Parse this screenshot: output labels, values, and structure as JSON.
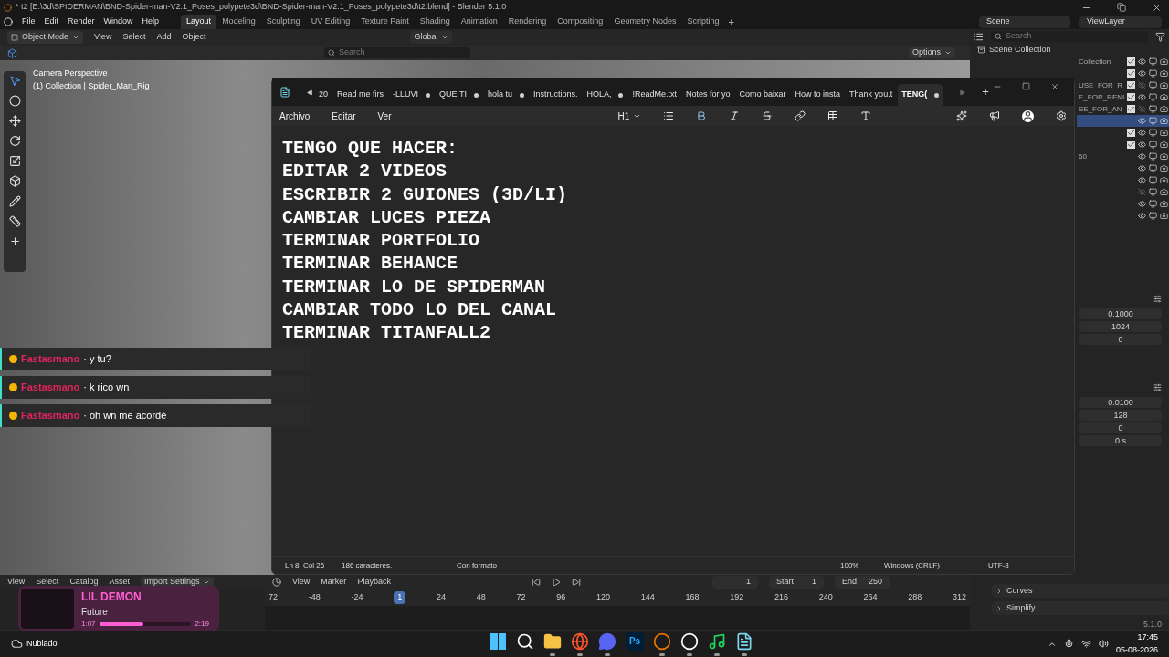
{
  "title_bar": {
    "title": "* t2 [E:\\3d\\SPIDERMAN\\BND-Spider-man-V2.1_Poses_polypete3d\\BND-Spider-man-V2.1_Poses_polypete3d\\t2.blend] - Blender 5.1.0"
  },
  "menu": [
    "File",
    "Edit",
    "Render",
    "Window",
    "Help"
  ],
  "workspaces": [
    {
      "label": "Layout",
      "selected": true
    },
    {
      "label": "Modeling",
      "selected": false
    },
    {
      "label": "Sculpting",
      "selected": false
    },
    {
      "label": "UV Editing",
      "selected": false
    },
    {
      "label": "Texture Paint",
      "selected": false
    },
    {
      "label": "Shading",
      "selected": false
    },
    {
      "label": "Animation",
      "selected": false
    },
    {
      "label": "Rendering",
      "selected": false
    },
    {
      "label": "Compositing",
      "selected": false
    },
    {
      "label": "Geometry Nodes",
      "selected": false
    },
    {
      "label": "Scripting",
      "selected": false
    }
  ],
  "add_workspace": "+",
  "scene": "Scene",
  "view_layer": "ViewLayer",
  "viewport": {
    "mode": "Object Mode",
    "menus": [
      "View",
      "Select",
      "Add",
      "Object"
    ],
    "orientation": "Global",
    "search_placeholder": "Search",
    "options": "Options",
    "camera": "Camera Perspective",
    "collection": "(1) Collection | Spider_Man_Rig"
  },
  "outliner": {
    "search_placeholder": "Search",
    "root": "Scene Collection",
    "rows": [
      {
        "label": "Collection",
        "kind": "collection",
        "visible": true,
        "selected": false
      },
      {
        "kind": "collection",
        "visible": true,
        "selected": false
      },
      {
        "label": "USE_FOR_R",
        "kind": "collection",
        "visible": false,
        "selected": false
      },
      {
        "label": "E_FOR_RENI",
        "kind": "collection",
        "visible": true,
        "selected": false
      },
      {
        "label": "SE_FOR_AN",
        "kind": "collection",
        "visible": false,
        "selected": false
      },
      {
        "kind": "object",
        "visible": true,
        "selected": true
      },
      {
        "kind": "collection",
        "visible": true,
        "selected": false
      },
      {
        "kind": "collection",
        "visible": true,
        "selected": false
      },
      {
        "label": "60",
        "kind": "object",
        "visible": true,
        "selected": false
      },
      {
        "kind": "object",
        "visible": true,
        "selected": false
      },
      {
        "kind": "object",
        "visible": true,
        "selected": false
      },
      {
        "kind": "object",
        "visible": false,
        "selected": false
      },
      {
        "kind": "object",
        "visible": true,
        "selected": false
      },
      {
        "kind": "object",
        "visible": true,
        "selected": false
      }
    ]
  },
  "properties": {
    "sections": [
      {
        "fields": [
          "0.1000",
          "1024",
          "0"
        ]
      },
      {
        "fields": [
          "0.0100",
          "128",
          "0",
          "0 s"
        ]
      }
    ],
    "panels": [
      "Curves",
      "Simplify"
    ]
  },
  "asset_browser": {
    "menus": [
      "View",
      "Select",
      "Catalog",
      "Asset"
    ],
    "import_settings": "Import Settings"
  },
  "timeline": {
    "menus": [
      "View",
      "Marker",
      "Playback"
    ],
    "current": "1",
    "start_label": "Start",
    "start": "1",
    "end_label": "End",
    "end": "250",
    "ticks": [
      {
        "label": "72",
        "selected": false
      },
      {
        "label": "-48",
        "selected": false
      },
      {
        "label": "-24",
        "selected": false
      },
      {
        "label": "1",
        "selected": true
      },
      {
        "label": "24",
        "selected": false
      },
      {
        "label": "48",
        "selected": false
      },
      {
        "label": "72",
        "selected": false
      },
      {
        "label": "96",
        "selected": false
      },
      {
        "label": "120",
        "selected": false
      },
      {
        "label": "144",
        "selected": false
      },
      {
        "label": "168",
        "selected": false
      },
      {
        "label": "192",
        "selected": false
      },
      {
        "label": "216",
        "selected": false
      },
      {
        "label": "240",
        "selected": false
      },
      {
        "label": "264",
        "selected": false
      },
      {
        "label": "288",
        "selected": false
      },
      {
        "label": "312",
        "selected": false
      }
    ]
  },
  "version": "5.1.0",
  "notepad": {
    "tabs": [
      {
        "label": "20",
        "modified": false,
        "selected": false
      },
      {
        "label": "Read me firs",
        "modified": false,
        "selected": false
      },
      {
        "label": "-LLUVI",
        "modified": true,
        "selected": false
      },
      {
        "label": "QUE TI",
        "modified": true,
        "selected": false
      },
      {
        "label": "hola tu",
        "modified": true,
        "selected": false
      },
      {
        "label": "Instructions.",
        "modified": false,
        "selected": false
      },
      {
        "label": "HOLA,",
        "modified": true,
        "selected": false
      },
      {
        "label": "!ReadMe.txt",
        "modified": false,
        "selected": false
      },
      {
        "label": "Notes for yo",
        "modified": false,
        "selected": false
      },
      {
        "label": "Como baixar",
        "modified": false,
        "selected": false
      },
      {
        "label": "How to insta",
        "modified": false,
        "selected": false
      },
      {
        "label": "Thank you.t",
        "modified": false,
        "selected": false
      },
      {
        "label": "TENG(",
        "modified": true,
        "selected": true
      }
    ],
    "add_tab": "+",
    "menus": [
      "Archivo",
      "Editar",
      "Ver"
    ],
    "heading": "H1",
    "lines": [
      "TENGO QUE HACER:",
      "EDITAR 2 VIDEOS",
      "ESCRIBIR 2 GUIONES (3D/LI)",
      "CAMBIAR LUCES PIEZA",
      "TERMINAR PORTFOLIO",
      "TERMINAR BEHANCE",
      "TERMINAR LO DE SPIDERMAN",
      "CAMBIAR TODO LO DEL CANAL",
      "TERMINAR TITANFALL2"
    ],
    "status": {
      "position": "Ln 8, Col 26",
      "count": "186 caracteres.",
      "format": "Con formato",
      "zoom": "100%",
      "line_endings": "Windows (CRLF)",
      "encoding": "UTF-8"
    }
  },
  "chat": [
    {
      "user": "Fastasmano",
      "text": "· y tu?"
    },
    {
      "user": "Fastasmano",
      "text": "· k rico wn"
    },
    {
      "user": "Fastasmano",
      "text": "· oh wn me acordé"
    }
  ],
  "music": {
    "title": "LIL DEMON",
    "artist": "Future",
    "elapsed": "1:07",
    "level": 0.48,
    "total": "2:19"
  },
  "taskbar": {
    "weather": "Nublado",
    "apps": [
      {
        "kind": "start",
        "running": false
      },
      {
        "kind": "search",
        "running": false
      },
      {
        "kind": "folder",
        "running": true
      },
      {
        "kind": "browser",
        "running": true
      },
      {
        "kind": "chat",
        "running": true
      },
      {
        "kind": "photoshop",
        "label": "Ps",
        "running": false
      },
      {
        "kind": "blender",
        "running": true
      },
      {
        "kind": "recorder",
        "running": true
      },
      {
        "kind": "music",
        "running": true
      },
      {
        "kind": "notepad",
        "running": true
      }
    ],
    "time": "17:45",
    "date": "05-08-2026"
  }
}
